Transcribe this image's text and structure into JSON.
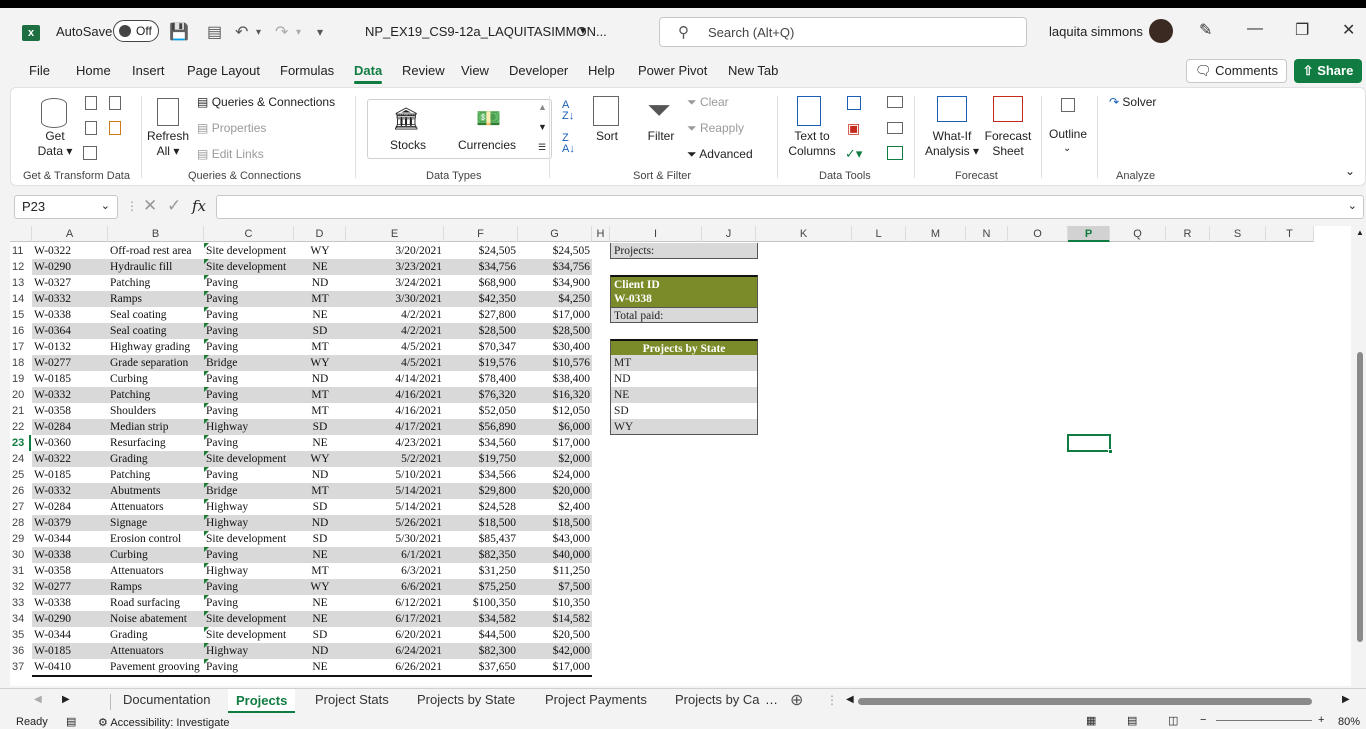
{
  "titlebar": {
    "autosave_label": "AutoSave",
    "autosave_state": "Off",
    "filename": "NP_EX19_CS9-12a_LAQUITASIMMON...",
    "search_placeholder": "Search (Alt+Q)",
    "username": "laquita simmons"
  },
  "menu": {
    "items": [
      "File",
      "Home",
      "Insert",
      "Page Layout",
      "Formulas",
      "Data",
      "Review",
      "View",
      "Developer",
      "Help",
      "Power Pivot",
      "New Tab"
    ],
    "active": "Data",
    "comments": "Comments",
    "share": "Share"
  },
  "ribbon": {
    "get_data": "Get Data",
    "refresh_all": "Refresh All",
    "queries_connections": "Queries & Connections",
    "properties": "Properties",
    "edit_links": "Edit Links",
    "stocks": "Stocks",
    "currencies": "Currencies",
    "sort": "Sort",
    "filter": "Filter",
    "clear": "Clear",
    "reapply": "Reapply",
    "advanced": "Advanced",
    "text_to_columns": "Text to Columns",
    "what_if": "What-If Analysis",
    "forecast_sheet": "Forecast Sheet",
    "outline": "Outline",
    "solver": "Solver",
    "groups": {
      "get_transform": "Get & Transform Data",
      "queries": "Queries & Connections",
      "data_types": "Data Types",
      "sort_filter": "Sort & Filter",
      "data_tools": "Data Tools",
      "forecast": "Forecast",
      "analyze": "Analyze"
    }
  },
  "formula_bar": {
    "name_box": "P23",
    "fx": "fx",
    "value": ""
  },
  "columns": [
    "A",
    "B",
    "C",
    "D",
    "E",
    "F",
    "G",
    "H",
    "I",
    "J",
    "K",
    "L",
    "M",
    "N",
    "O",
    "P",
    "Q",
    "R",
    "S",
    "T"
  ],
  "selected_column": "P",
  "selected_row": "23",
  "rows": [
    [
      "11",
      "W-0322",
      "Off-road rest area",
      "Site development",
      "WY",
      "3/20/2021",
      "$24,505",
      "$24,505"
    ],
    [
      "12",
      "W-0290",
      "Hydraulic fill",
      "Site development",
      "NE",
      "3/23/2021",
      "$34,756",
      "$34,756"
    ],
    [
      "13",
      "W-0327",
      "Patching",
      "Paving",
      "ND",
      "3/24/2021",
      "$68,900",
      "$34,900"
    ],
    [
      "14",
      "W-0332",
      "Ramps",
      "Paving",
      "MT",
      "3/30/2021",
      "$42,350",
      "$4,250"
    ],
    [
      "15",
      "W-0338",
      "Seal coating",
      "Paving",
      "NE",
      "4/2/2021",
      "$27,800",
      "$17,000"
    ],
    [
      "16",
      "W-0364",
      "Seal coating",
      "Paving",
      "SD",
      "4/2/2021",
      "$28,500",
      "$28,500"
    ],
    [
      "17",
      "W-0132",
      "Highway grading",
      "Paving",
      "MT",
      "4/5/2021",
      "$70,347",
      "$30,400"
    ],
    [
      "18",
      "W-0277",
      "Grade separation",
      "Bridge",
      "WY",
      "4/5/2021",
      "$19,576",
      "$10,576"
    ],
    [
      "19",
      "W-0185",
      "Curbing",
      "Paving",
      "ND",
      "4/14/2021",
      "$78,400",
      "$38,400"
    ],
    [
      "20",
      "W-0332",
      "Patching",
      "Paving",
      "MT",
      "4/16/2021",
      "$76,320",
      "$16,320"
    ],
    [
      "21",
      "W-0358",
      "Shoulders",
      "Paving",
      "MT",
      "4/16/2021",
      "$52,050",
      "$12,050"
    ],
    [
      "22",
      "W-0284",
      "Median strip",
      "Highway",
      "SD",
      "4/17/2021",
      "$56,890",
      "$6,000"
    ],
    [
      "23",
      "W-0360",
      "Resurfacing",
      "Paving",
      "NE",
      "4/23/2021",
      "$34,560",
      "$17,000"
    ],
    [
      "24",
      "W-0322",
      "Grading",
      "Site development",
      "WY",
      "5/2/2021",
      "$19,750",
      "$2,000"
    ],
    [
      "25",
      "W-0185",
      "Patching",
      "Paving",
      "ND",
      "5/10/2021",
      "$34,566",
      "$24,000"
    ],
    [
      "26",
      "W-0332",
      "Abutments",
      "Bridge",
      "MT",
      "5/14/2021",
      "$29,800",
      "$20,000"
    ],
    [
      "27",
      "W-0284",
      "Attenuators",
      "Highway",
      "SD",
      "5/14/2021",
      "$24,528",
      "$2,400"
    ],
    [
      "28",
      "W-0379",
      "Signage",
      "Highway",
      "ND",
      "5/26/2021",
      "$18,500",
      "$18,500"
    ],
    [
      "29",
      "W-0344",
      "Erosion control",
      "Site development",
      "SD",
      "5/30/2021",
      "$85,437",
      "$43,000"
    ],
    [
      "30",
      "W-0338",
      "Curbing",
      "Paving",
      "NE",
      "6/1/2021",
      "$82,350",
      "$40,000"
    ],
    [
      "31",
      "W-0358",
      "Attenuators",
      "Highway",
      "MT",
      "6/3/2021",
      "$31,250",
      "$11,250"
    ],
    [
      "32",
      "W-0277",
      "Ramps",
      "Paving",
      "WY",
      "6/6/2021",
      "$75,250",
      "$7,500"
    ],
    [
      "33",
      "W-0338",
      "Road surfacing",
      "Paving",
      "NE",
      "6/12/2021",
      "$100,350",
      "$10,350"
    ],
    [
      "34",
      "W-0290",
      "Noise abatement",
      "Site development",
      "NE",
      "6/17/2021",
      "$34,582",
      "$14,582"
    ],
    [
      "35",
      "W-0344",
      "Grading",
      "Site development",
      "SD",
      "6/20/2021",
      "$44,500",
      "$20,500"
    ],
    [
      "36",
      "W-0185",
      "Attenuators",
      "Highway",
      "ND",
      "6/24/2021",
      "$82,300",
      "$42,000"
    ],
    [
      "37",
      "W-0410",
      "Pavement grooving",
      "Paving",
      "NE",
      "6/26/2021",
      "$37,650",
      "$17,000"
    ]
  ],
  "side_panel": {
    "projects_label": "Projects:",
    "client_id_label": "Client ID",
    "client_id_value": "W-0338",
    "total_paid_label": "Total paid:",
    "by_state_header": "Projects by State",
    "states": [
      "MT",
      "ND",
      "NE",
      "SD",
      "WY"
    ]
  },
  "sheet_tabs": [
    "Documentation",
    "Projects",
    "Project Stats",
    "Projects by State",
    "Project Payments",
    "Projects by Ca"
  ],
  "active_tab": "Projects",
  "status": {
    "ready": "Ready",
    "accessibility": "Accessibility: Investigate",
    "zoom": "80%"
  },
  "colors": {
    "accent": "#107c41",
    "olive_header": "#7b8b2a",
    "row_shade": "#d9d9d9"
  }
}
